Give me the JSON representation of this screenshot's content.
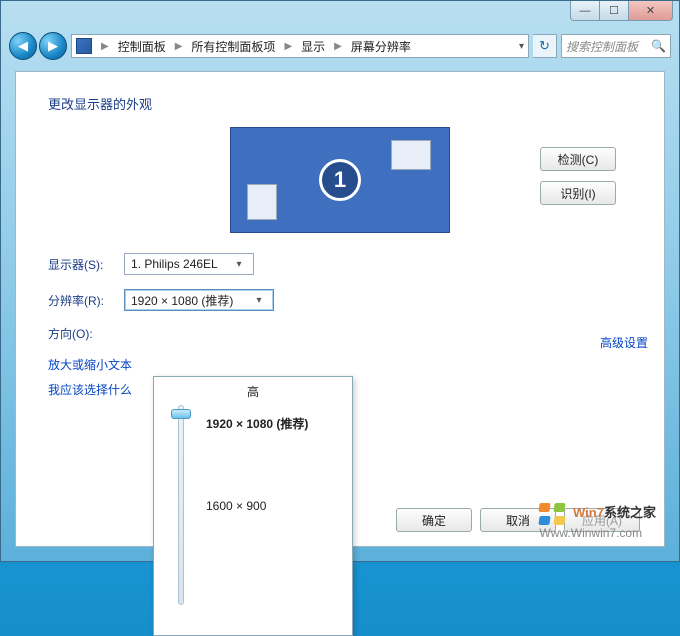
{
  "titlebar": {
    "min_glyph": "—",
    "max_glyph": "☐",
    "close_glyph": "✕"
  },
  "toolbar": {
    "nav_back_glyph": "◀",
    "nav_fwd_glyph": "▶",
    "breadcrumbs": [
      "控制面板",
      "所有控制面板项",
      "显示",
      "屏幕分辨率"
    ],
    "arrow_glyph": "▶",
    "address_drop_glyph": "▾",
    "refresh_glyph": "↻",
    "search_placeholder": "搜索控制面板",
    "search_icon_glyph": "🔍"
  },
  "page": {
    "title": "更改显示器的外观",
    "monitor_number": "1",
    "detect_button": "检测(C)",
    "identify_button": "识别(I)",
    "labels": {
      "display": "显示器(S):",
      "resolution": "分辨率(R):",
      "orientation": "方向(O):"
    },
    "display_value": "1. Philips 246EL",
    "resolution_value": "1920 × 1080 (推荐)",
    "dropdown_glyph": "▾",
    "advanced_link": "高级设置",
    "help_links": [
      "放大或缩小文本",
      "我应该选择什么"
    ],
    "buttons": {
      "ok": "确定",
      "cancel": "取消",
      "apply": "应用(A)"
    }
  },
  "resolution_flyout": {
    "top_label": "高",
    "options": [
      "1920 × 1080 (推荐)",
      "1600 × 900"
    ]
  },
  "watermark": {
    "line1a": "Win7",
    "line1b": "系统之家",
    "line2": "Www.Winwin7.com"
  }
}
